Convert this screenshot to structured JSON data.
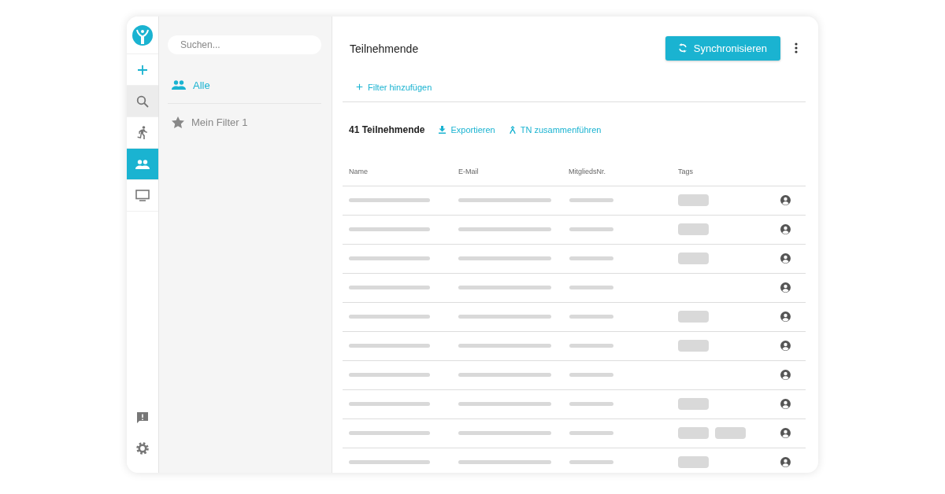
{
  "rail": {
    "top": [
      {
        "kind": "add",
        "selected": false,
        "hovered": false
      },
      {
        "kind": "search",
        "selected": false,
        "hovered": true
      },
      {
        "kind": "activity",
        "selected": false,
        "hovered": false
      },
      {
        "kind": "people",
        "selected": true,
        "hovered": false
      },
      {
        "kind": "screen",
        "selected": false,
        "hovered": false
      }
    ],
    "bottom": [
      {
        "kind": "feedback",
        "selected": false,
        "hovered": false
      },
      {
        "kind": "settings",
        "selected": false,
        "hovered": false
      }
    ]
  },
  "filters": {
    "search": {
      "placeholder": "Suchen..."
    },
    "items": [
      {
        "label": "Alle",
        "kind": "people",
        "selected": true
      },
      {
        "label": "Mein Filter 1",
        "kind": "star",
        "selected": false
      }
    ]
  },
  "main": {
    "title": "Teilnehmende",
    "sync_button": "Synchronisieren",
    "add_filter": "Filter hinzufügen",
    "count": "41 Teilnehmende",
    "export": "Exportieren",
    "merge": "TN zusammenführen",
    "table": {
      "columns": [
        "Name",
        "E-Mail",
        "MitgliedsNr.",
        "Tags"
      ],
      "rows": [
        {
          "kind": "skeleton",
          "tags": [
            {
              "kind": "pill"
            }
          ]
        },
        {
          "kind": "skeleton",
          "tags": [
            {
              "kind": "pill"
            }
          ]
        },
        {
          "kind": "skeleton",
          "tags": [
            {
              "kind": "pill"
            }
          ]
        },
        {
          "kind": "skeleton"
        },
        {
          "kind": "skeleton",
          "tags": [
            {
              "kind": "pill"
            }
          ]
        },
        {
          "kind": "skeleton",
          "tags": [
            {
              "kind": "pill"
            }
          ]
        },
        {
          "kind": "skeleton"
        },
        {
          "kind": "skeleton",
          "tags": [
            {
              "kind": "pill"
            }
          ]
        },
        {
          "kind": "skeleton",
          "tags": [
            {
              "kind": "pill"
            },
            {
              "kind": "pill"
            }
          ]
        },
        {
          "kind": "skeleton",
          "tags": [
            {
              "kind": "pill"
            }
          ]
        }
      ]
    }
  }
}
